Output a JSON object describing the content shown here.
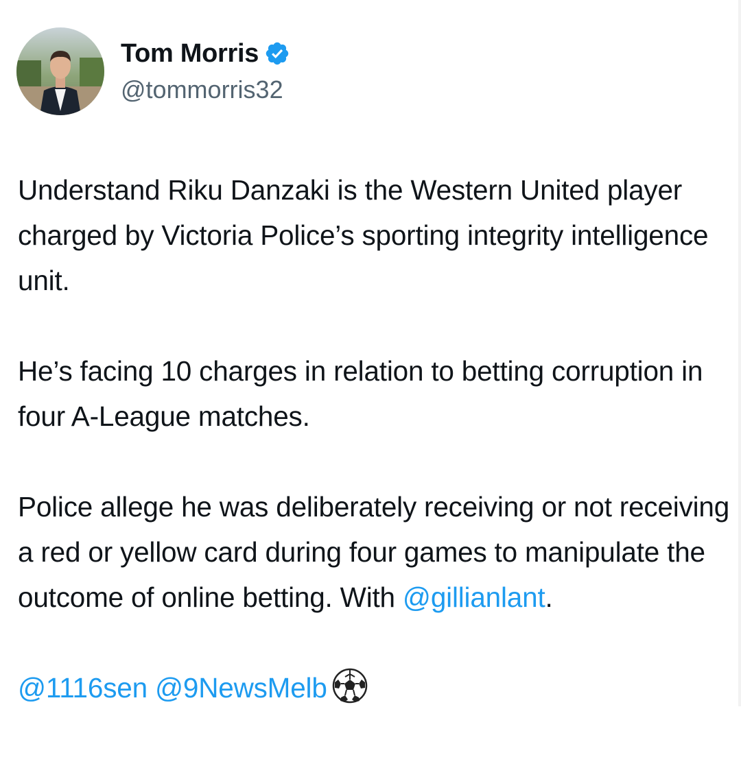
{
  "author": {
    "display_name": "Tom Morris",
    "handle": "@tommorris32",
    "verified": true
  },
  "tweet": {
    "para1": "Understand Riku Danzaki is the Western United player charged by Victoria Police’s sporting integrity intelligence unit.",
    "para2": "He’s facing 10 charges in relation to betting corruption in four A-League matches.",
    "para3_text": "Police allege he was deliberately receiving or not receiving a red or yellow card during four games to manipulate the outcome of online betting. With ",
    "para3_mention": "@gillianlant",
    "para3_end": ".",
    "mention1": "@1116sen",
    "mention2": "@9NewsMelb",
    "emoji": "soccer-ball"
  },
  "colors": {
    "link": "#1d9bf0",
    "verified_badge": "#1d9bf0",
    "text": "#0f1419",
    "handle": "#536471"
  }
}
